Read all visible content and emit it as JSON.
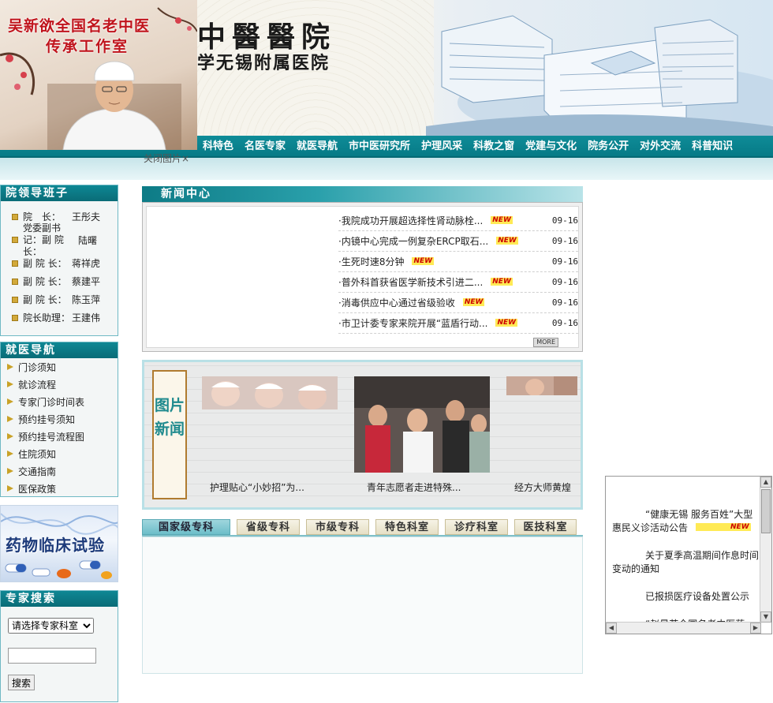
{
  "header": {
    "hospital_name": "中醫醫院",
    "hospital_subtitle": "学无锡附属医院"
  },
  "promo": {
    "line1": "吴新欲全国名老中医",
    "line2": "传承工作室",
    "close_label": "关闭图片×"
  },
  "nav": {
    "items": [
      "科特色",
      "名医专家",
      "就医导航",
      "市中医研究所",
      "护理风采",
      "科教之窗",
      "党建与文化",
      "院务公开",
      "对外交流",
      "科普知识"
    ]
  },
  "leadership": {
    "title": "院领导班子",
    "members": [
      {
        "role": "院　长：",
        "name": "王彤夫"
      },
      {
        "role": "党委副书记：副 院 长：",
        "name": "陆曙"
      },
      {
        "role": "副 院 长：",
        "name": "蒋祥虎"
      },
      {
        "role": "副 院 长：",
        "name": "蔡建平"
      },
      {
        "role": "副 院 长：",
        "name": "陈玉萍"
      },
      {
        "role": "院长助理：",
        "name": "王建伟"
      }
    ]
  },
  "guide": {
    "title": "就医导航",
    "items": [
      "门诊须知",
      "就诊流程",
      "专家门诊时间表",
      "预约挂号须知",
      "预约挂号流程图",
      "住院须知",
      "交通指南",
      "医保政策"
    ]
  },
  "banner": {
    "text": "药物临床试验"
  },
  "expert_search": {
    "title": "专家搜索",
    "select_value": "请选择专家科室",
    "input_value": "",
    "button_label": "搜索"
  },
  "news": {
    "title": "新闻中心",
    "items": [
      {
        "title": "·我院成功开展超选择性肾动脉栓...",
        "date": "09-16"
      },
      {
        "title": "·内镜中心完成一例复杂ERCP取石...",
        "date": "09-16"
      },
      {
        "title": "·生死时速8分钟",
        "date": "09-16"
      },
      {
        "title": "·普外科首获省医学新技术引进二...",
        "date": "09-16"
      },
      {
        "title": "·消毒供应中心通过省级验收",
        "date": "09-16"
      },
      {
        "title": "·市卫计委专家来院开展“蓝盾行动...",
        "date": "09-16"
      }
    ],
    "new_tag": "NEW",
    "more_label": "MORE"
  },
  "photo_news": {
    "label": "图片新闻",
    "items": [
      {
        "caption": "护理贴心“小妙招”为..."
      },
      {
        "caption": "青年志愿者走进特殊..."
      },
      {
        "caption": "经方大师黄煌"
      }
    ]
  },
  "dept_tabs": {
    "items": [
      "国家级专科",
      "省级专科",
      "市级专科",
      "特色科室",
      "诊疗科室",
      "医技科室"
    ],
    "active": 0
  },
  "notices": {
    "items": [
      {
        "text": "“健康无锡 服务百姓”大型惠民义诊活动公告",
        "is_new": true
      },
      {
        "text": "关于夏季高温期间作息时间变动的通知",
        "is_new": false
      },
      {
        "text": "已报损医疗设备处置公示",
        "is_new": false
      },
      {
        "text": "“赵景芳全国名老中医药",
        "is_new": false
      }
    ]
  },
  "colors": {
    "nav_teal": "#0f8c98",
    "section_teal": "#0d7b86",
    "promo_red": "#c0141c",
    "new_tag_yellow": "#ffea55"
  }
}
